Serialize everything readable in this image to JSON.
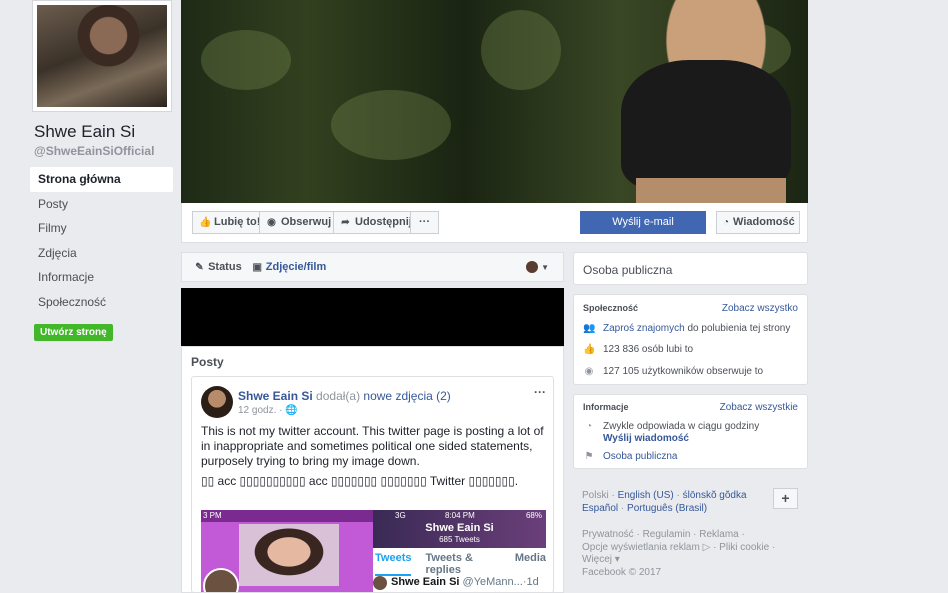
{
  "profile": {
    "name": "Shwe Eain Si",
    "handle": "@ShweEainSiOfficial"
  },
  "left_nav": {
    "items": [
      {
        "label": "Strona główna",
        "active": true
      },
      {
        "label": "Posty"
      },
      {
        "label": "Filmy"
      },
      {
        "label": "Zdjęcia"
      },
      {
        "label": "Informacje"
      },
      {
        "label": "Społeczność"
      }
    ],
    "create_page": "Utwórz stronę"
  },
  "actions": {
    "like": "Lubię to!",
    "follow": "Obserwuj",
    "share": "Udostępnij",
    "more": "···",
    "email": "Wyślij e-mail",
    "message": "Wiadomość"
  },
  "composer": {
    "status": "Status",
    "photo_video": "Zdjęcie/film"
  },
  "posts_section": {
    "title": "Posty"
  },
  "post": {
    "author": "Shwe Eain Si",
    "added": "dodał(a)",
    "new_photos": "nowe zdjęcia (2)",
    "time": "12 godz. ·",
    "text": "This is not my twitter account. This twitter page is posting a lot of in inappropriate and sometimes political one sided statements, purposely trying to bring my image down.",
    "text_burmese": "▯▯ acc ▯▯▯▯▯▯▯▯▯▯ acc ▯▯▯▯▯▯▯ ▯▯▯▯▯▯▯ Twitter ▯▯▯▯▯▯▯.",
    "photo1_status": "3 PM",
    "twitter": {
      "status_left": "3G",
      "status_time": "8:04 PM",
      "status_right": "68%",
      "profile_name": "Shwe Eain Si",
      "tweet_count": "685 Tweets",
      "tab_tweets": "Tweets",
      "tab_replies": "Tweets & replies",
      "tab_media": "Media",
      "tweet_author": "Shwe Eain Si",
      "tweet_handle": "@YeMann...·1d"
    }
  },
  "sidebar": {
    "category": "Osoba publiczna",
    "community": {
      "title": "Społeczność",
      "see_all": "Zobacz wszystko",
      "invite_link": "Zaproś znajomych",
      "invite_rest": "do polubienia tej strony",
      "likes": "123 836 osób lubi to",
      "followers": "127 105 użytkowników obserwuje to"
    },
    "info": {
      "title": "Informacje",
      "see_all": "Zobacz wszystkie",
      "response": "Zwykle odpowiada w ciągu godziny",
      "send_message": "Wyślij wiadomość",
      "category": "Osoba publiczna"
    },
    "languages": {
      "current": "Polski",
      "items": [
        "English (US)",
        "ślōnskŏ gŏdka",
        "Español",
        "Português (Brasil)"
      ],
      "plus": "+"
    },
    "footer": {
      "line1": "Prywatność · Regulamin · Reklama ·",
      "line2": "Opcje wyświetlania reklam ▷ · Pliki cookie ·",
      "line3": "Więcej ▾",
      "line4": "Facebook © 2017"
    }
  }
}
